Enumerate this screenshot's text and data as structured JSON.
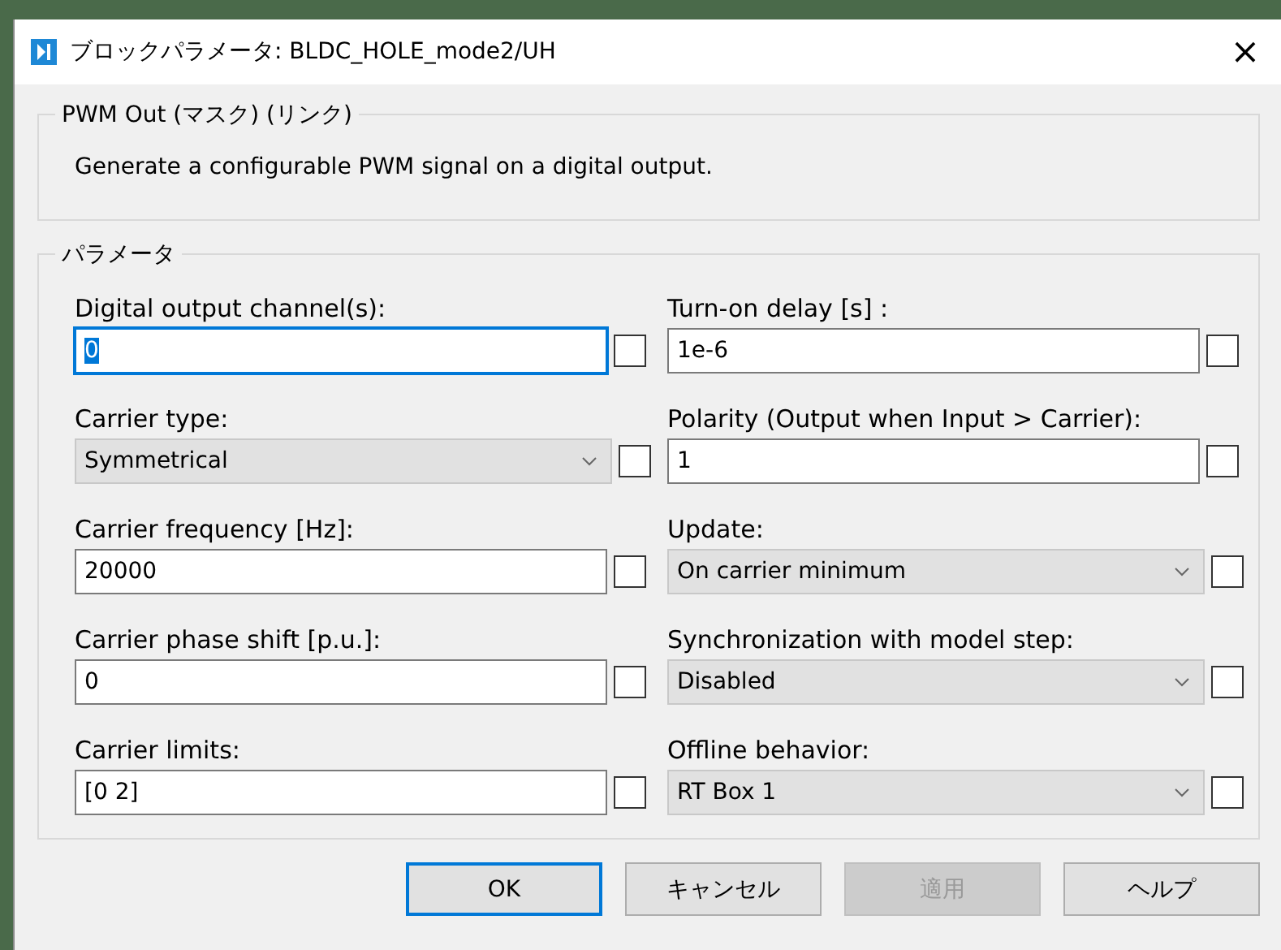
{
  "window": {
    "title": "ブロックパラメータ: BLDC_HOLE_mode2/UH",
    "close": "×"
  },
  "description": {
    "title": "PWM Out (マスク) (リンク)",
    "text": "Generate a configurable PWM signal on a digital output."
  },
  "parameters": {
    "title": "パラメータ",
    "left_column": [
      {
        "label": "Digital output channel(s):",
        "kind": "edit",
        "value": "0",
        "focused": true,
        "checked": false
      },
      {
        "label": "Carrier type:",
        "kind": "dropdown",
        "value": "Symmetrical",
        "focused": false,
        "checked": false
      },
      {
        "label": "Carrier frequency [Hz]:",
        "kind": "edit",
        "value": "20000",
        "focused": false,
        "checked": false
      },
      {
        "label": "Carrier phase shift [p.u.]:",
        "kind": "edit",
        "value": "0",
        "focused": false,
        "checked": false
      },
      {
        "label": "Carrier limits:",
        "kind": "edit",
        "value": "[0 2]",
        "focused": false,
        "checked": false
      }
    ],
    "right_column": [
      {
        "label": "Turn-on delay [s] :",
        "kind": "edit",
        "value": "1e-6",
        "focused": false,
        "checked": false
      },
      {
        "label": "Polarity (Output when Input > Carrier):",
        "kind": "edit",
        "value": "1",
        "focused": false,
        "checked": false
      },
      {
        "label": "Update:",
        "kind": "dropdown",
        "value": "On carrier minimum",
        "focused": false,
        "checked": false
      },
      {
        "label": "Synchronization with model step:",
        "kind": "dropdown",
        "value": "Disabled",
        "focused": false,
        "checked": false
      },
      {
        "label": "Offline behavior:",
        "kind": "dropdown",
        "value": "RT Box 1",
        "focused": false,
        "checked": false
      }
    ]
  },
  "buttons": [
    {
      "label": "OK",
      "default": true,
      "disabled": false
    },
    {
      "label": "キャンセル",
      "default": false,
      "disabled": false
    },
    {
      "label": "適用",
      "default": false,
      "disabled": true
    },
    {
      "label": "ヘルプ",
      "default": false,
      "disabled": false
    }
  ]
}
